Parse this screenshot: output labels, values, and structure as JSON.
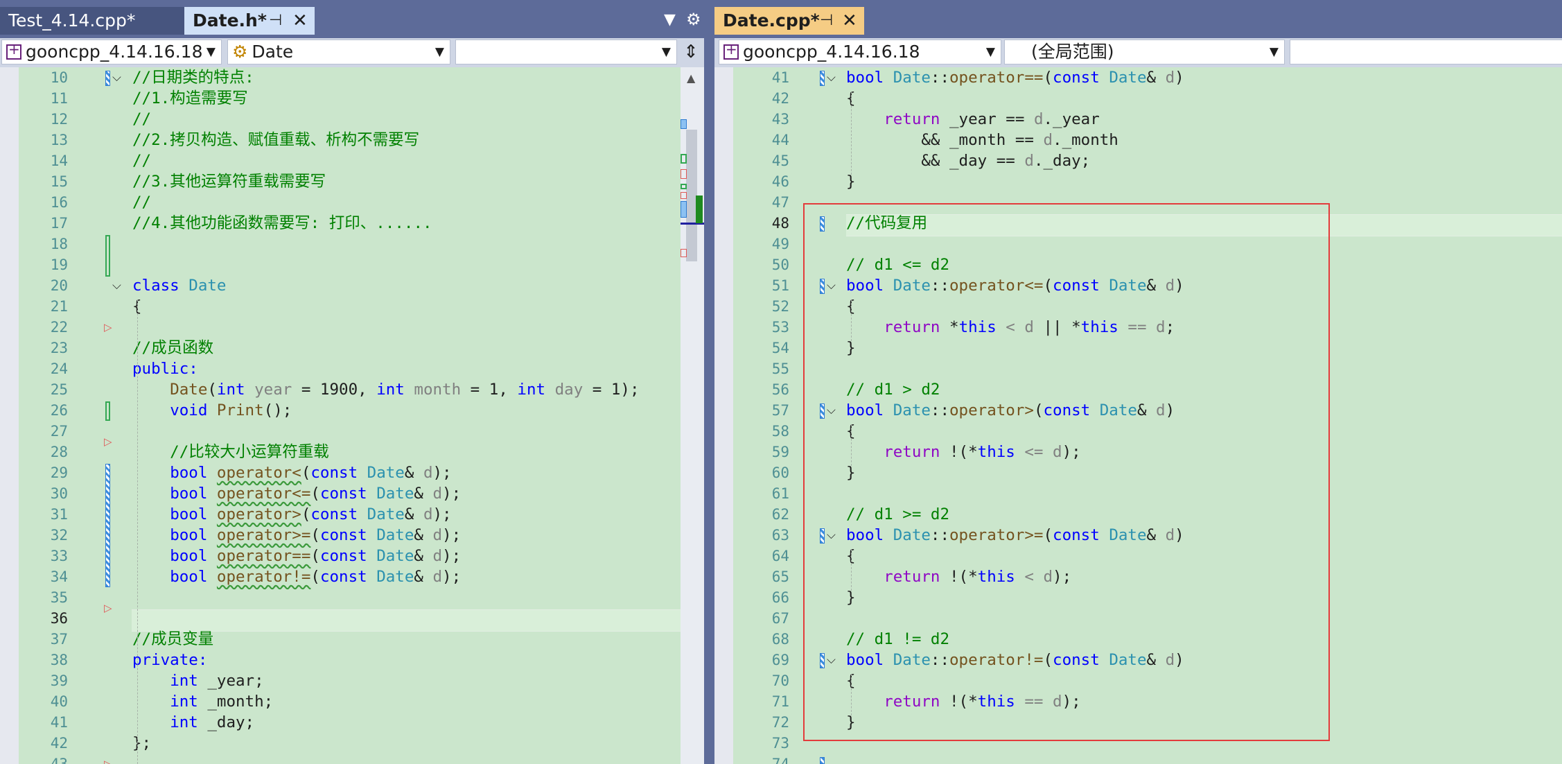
{
  "left_pane": {
    "tabs": [
      {
        "label": "Test_4.14.cpp*",
        "active": false
      },
      {
        "label": "Date.h*",
        "active": true
      }
    ],
    "nav": {
      "project": "gooncpp_4.14.16.18",
      "scope": "Date",
      "member": ""
    },
    "lines": [
      {
        "n": "10",
        "code": "//日期类的特点:"
      },
      {
        "n": "11",
        "code": "//1.构造需要写"
      },
      {
        "n": "12",
        "code": "//"
      },
      {
        "n": "13",
        "code": "//2.拷贝构造、赋值重载、析构不需要写"
      },
      {
        "n": "14",
        "code": "//"
      },
      {
        "n": "15",
        "code": "//3.其他运算符重载需要写"
      },
      {
        "n": "16",
        "code": "//"
      },
      {
        "n": "17",
        "code": "//4.其他功能函数需要写: 打印、......"
      },
      {
        "n": "18",
        "code": ""
      },
      {
        "n": "19",
        "code": ""
      },
      {
        "n": "20",
        "code": "class Date"
      },
      {
        "n": "21",
        "code": "{"
      },
      {
        "n": "22",
        "code": ""
      },
      {
        "n": "23",
        "code": "//成员函数"
      },
      {
        "n": "24",
        "code": "public:"
      },
      {
        "n": "25",
        "code": "    Date(int year = 1900, int month = 1, int day = 1);"
      },
      {
        "n": "26",
        "code": "    void Print();"
      },
      {
        "n": "27",
        "code": ""
      },
      {
        "n": "28",
        "code": "    //比较大小运算符重载"
      },
      {
        "n": "29",
        "code": "    bool operator<(const Date& d);"
      },
      {
        "n": "30",
        "code": "    bool operator<=(const Date& d);"
      },
      {
        "n": "31",
        "code": "    bool operator>(const Date& d);"
      },
      {
        "n": "32",
        "code": "    bool operator>=(const Date& d);"
      },
      {
        "n": "33",
        "code": "    bool operator==(const Date& d);"
      },
      {
        "n": "34",
        "code": "    bool operator!=(const Date& d);"
      },
      {
        "n": "35",
        "code": ""
      },
      {
        "n": "36",
        "code": ""
      },
      {
        "n": "37",
        "code": "//成员变量"
      },
      {
        "n": "38",
        "code": "private:"
      },
      {
        "n": "39",
        "code": "    int _year;"
      },
      {
        "n": "40",
        "code": "    int _month;"
      },
      {
        "n": "41",
        "code": "    int _day;"
      },
      {
        "n": "42",
        "code": "};"
      },
      {
        "n": "43",
        "code": ""
      }
    ]
  },
  "right_pane": {
    "tabs": [
      {
        "label": "Date.cpp*",
        "active": true
      }
    ],
    "nav": {
      "project": "gooncpp_4.14.16.18",
      "scope": "(全局范围)",
      "member": ""
    },
    "lines": [
      {
        "n": "41",
        "code": "bool Date::operator==(const Date& d)"
      },
      {
        "n": "42",
        "code": "{"
      },
      {
        "n": "43",
        "code": "    return _year == d._year"
      },
      {
        "n": "44",
        "code": "        && _month == d._month"
      },
      {
        "n": "45",
        "code": "        && _day == d._day;"
      },
      {
        "n": "46",
        "code": "}"
      },
      {
        "n": "47",
        "code": ""
      },
      {
        "n": "48",
        "code": "//代码复用"
      },
      {
        "n": "49",
        "code": ""
      },
      {
        "n": "50",
        "code": "// d1 <= d2"
      },
      {
        "n": "51",
        "code": "bool Date::operator<=(const Date& d)"
      },
      {
        "n": "52",
        "code": "{"
      },
      {
        "n": "53",
        "code": "    return *this < d || *this == d;"
      },
      {
        "n": "54",
        "code": "}"
      },
      {
        "n": "55",
        "code": ""
      },
      {
        "n": "56",
        "code": "// d1 > d2"
      },
      {
        "n": "57",
        "code": "bool Date::operator>(const Date& d)"
      },
      {
        "n": "58",
        "code": "{"
      },
      {
        "n": "59",
        "code": "    return !(*this <= d);"
      },
      {
        "n": "60",
        "code": "}"
      },
      {
        "n": "61",
        "code": ""
      },
      {
        "n": "62",
        "code": "// d1 >= d2"
      },
      {
        "n": "63",
        "code": "bool Date::operator>=(const Date& d)"
      },
      {
        "n": "64",
        "code": "{"
      },
      {
        "n": "65",
        "code": "    return !(*this < d);"
      },
      {
        "n": "66",
        "code": "}"
      },
      {
        "n": "67",
        "code": ""
      },
      {
        "n": "68",
        "code": "// d1 != d2"
      },
      {
        "n": "69",
        "code": "bool Date::operator!=(const Date& d)"
      },
      {
        "n": "70",
        "code": "{"
      },
      {
        "n": "71",
        "code": "    return !(*this == d);"
      },
      {
        "n": "72",
        "code": "}"
      },
      {
        "n": "73",
        "code": ""
      },
      {
        "n": "74",
        "code": ""
      }
    ]
  },
  "icons": {
    "tab_pin": "pin-icon",
    "tab_close": "close-icon",
    "dropdown": "chevron-down-icon",
    "settings": "gear-icon",
    "project": "cpp-project-icon",
    "class": "class-icon",
    "split": "split-window-icon"
  },
  "colors": {
    "editor_bg": "#cbe6cc",
    "active_tab": "#f5cc84",
    "tab_strip": "#5d6b99",
    "keyword": "#0000ff",
    "control_keyword": "#8f08c4",
    "type": "#2b91af",
    "comment": "#008000",
    "parameter": "#808080",
    "highlight_box": "#e33b3b"
  }
}
